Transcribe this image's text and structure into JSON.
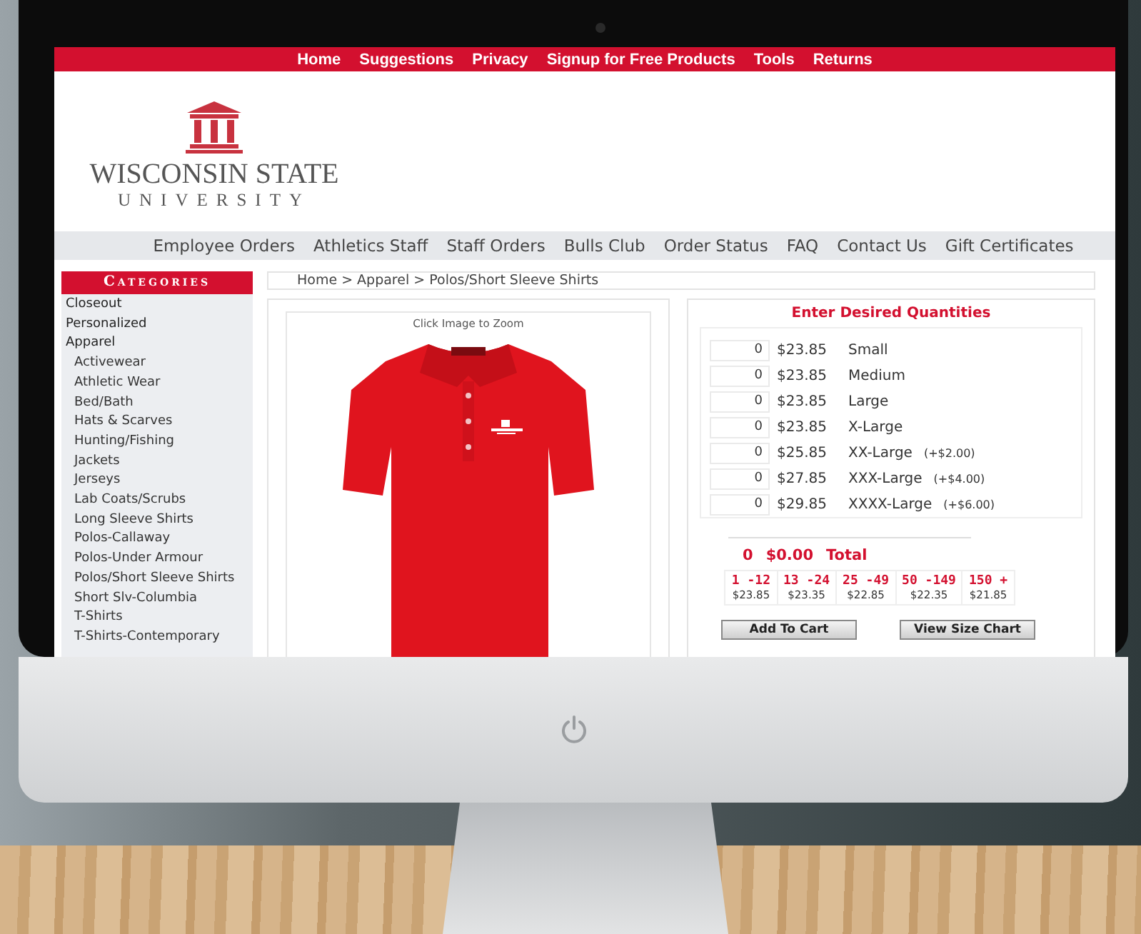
{
  "top_nav": [
    "Home",
    "Suggestions",
    "Privacy",
    "Signup for Free Products",
    "Tools",
    "Returns"
  ],
  "logo": {
    "name": "WISCONSIN STATE",
    "subtitle": "UNIVERSITY"
  },
  "sub_nav": [
    "Employee Orders",
    "Athletics Staff",
    "Staff Orders",
    "Bulls Club",
    "Order Status",
    "FAQ",
    "Contact Us",
    "Gift Certificates"
  ],
  "sidebar": {
    "title": "Categories",
    "items": [
      {
        "label": "Closeout"
      },
      {
        "label": "Personalized"
      },
      {
        "label": "Apparel",
        "children": [
          {
            "label": "Activewear"
          },
          {
            "label": "Athletic Wear"
          },
          {
            "label": "Bed/Bath"
          },
          {
            "label": "Hats & Scarves"
          },
          {
            "label": "Hunting/Fishing"
          },
          {
            "label": "Jackets"
          },
          {
            "label": "Jerseys"
          },
          {
            "label": "Lab Coats/Scrubs"
          },
          {
            "label": "Long Sleeve Shirts"
          },
          {
            "label": "Polos-Callaway"
          },
          {
            "label": "Polos-Under Armour"
          },
          {
            "label": "Polos/Short Sleeve Shirts"
          },
          {
            "label": "Short Slv-Columbia"
          },
          {
            "label": "T-Shirts"
          },
          {
            "label": "T-Shirts-Contemporary"
          }
        ]
      }
    ]
  },
  "breadcrumb": "Home > Apparel > Polos/Short Sleeve Shirts",
  "product": {
    "caption": "Click Image to Zoom"
  },
  "quantities": {
    "title": "Enter Desired Quantities",
    "rows": [
      {
        "qty": "0",
        "price": "$23.85",
        "size": "Small"
      },
      {
        "qty": "0",
        "price": "$23.85",
        "size": "Medium"
      },
      {
        "qty": "0",
        "price": "$23.85",
        "size": "Large"
      },
      {
        "qty": "0",
        "price": "$23.85",
        "size": "X-Large"
      },
      {
        "qty": "0",
        "price": "$25.85",
        "size": "XX-Large",
        "surcharge": "(+$2.00)"
      },
      {
        "qty": "0",
        "price": "$27.85",
        "size": "XXX-Large",
        "surcharge": "(+$4.00)"
      },
      {
        "qty": "0",
        "price": "$29.85",
        "size": "XXXX-Large",
        "surcharge": "(+$6.00)"
      }
    ],
    "total": {
      "qty": "0",
      "amount": "$0.00",
      "label": "Total"
    },
    "tiers": [
      {
        "range": "1 -12",
        "price": "$23.85"
      },
      {
        "range": "13 -24",
        "price": "$23.35"
      },
      {
        "range": "25 -49",
        "price": "$22.85"
      },
      {
        "range": "50 -149",
        "price": "$22.35"
      },
      {
        "range": "150 +",
        "price": "$21.85"
      }
    ],
    "buttons": [
      "Add To Cart",
      "View Size Chart"
    ]
  }
}
